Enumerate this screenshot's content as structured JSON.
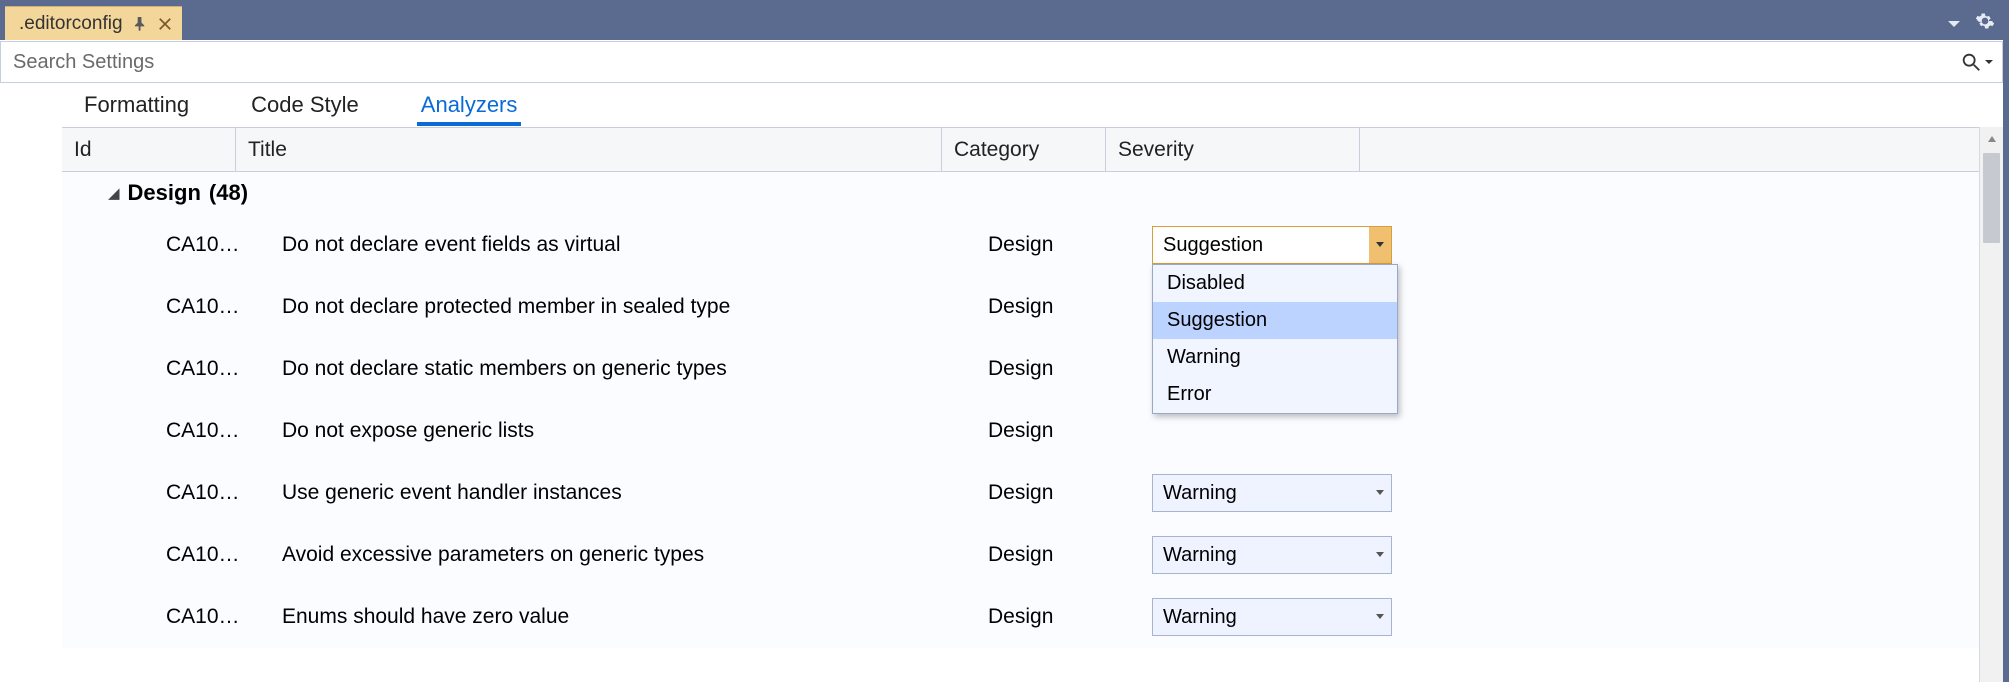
{
  "titlebar": {
    "filename": ".editorconfig"
  },
  "search": {
    "placeholder": "Search Settings"
  },
  "tabs": [
    {
      "label": "Formatting",
      "active": false
    },
    {
      "label": "Code Style",
      "active": false
    },
    {
      "label": "Analyzers",
      "active": true
    }
  ],
  "columns": {
    "id": "Id",
    "title": "Title",
    "category": "Category",
    "severity": "Severity"
  },
  "group": {
    "name": "Design",
    "count": "(48)"
  },
  "rows": [
    {
      "id": "CA10…",
      "title": "Do not declare event fields as virtual",
      "category": "Design",
      "severity": "Suggestion",
      "open": true
    },
    {
      "id": "CA10…",
      "title": "Do not declare protected member in sealed type",
      "category": "Design",
      "severity": "",
      "open": false
    },
    {
      "id": "CA10…",
      "title": "Do not declare static members on generic types",
      "category": "Design",
      "severity": "",
      "open": false
    },
    {
      "id": "CA10…",
      "title": "Do not expose generic lists",
      "category": "Design",
      "severity": "",
      "open": false
    },
    {
      "id": "CA10…",
      "title": "Use generic event handler instances",
      "category": "Design",
      "severity": "Warning",
      "open": false
    },
    {
      "id": "CA10…",
      "title": "Avoid excessive parameters on generic types",
      "category": "Design",
      "severity": "Warning",
      "open": false
    },
    {
      "id": "CA10…",
      "title": "Enums should have zero value",
      "category": "Design",
      "severity": "Warning",
      "open": false
    }
  ],
  "severity_options": [
    "Disabled",
    "Suggestion",
    "Warning",
    "Error"
  ],
  "selected_option": "Suggestion"
}
